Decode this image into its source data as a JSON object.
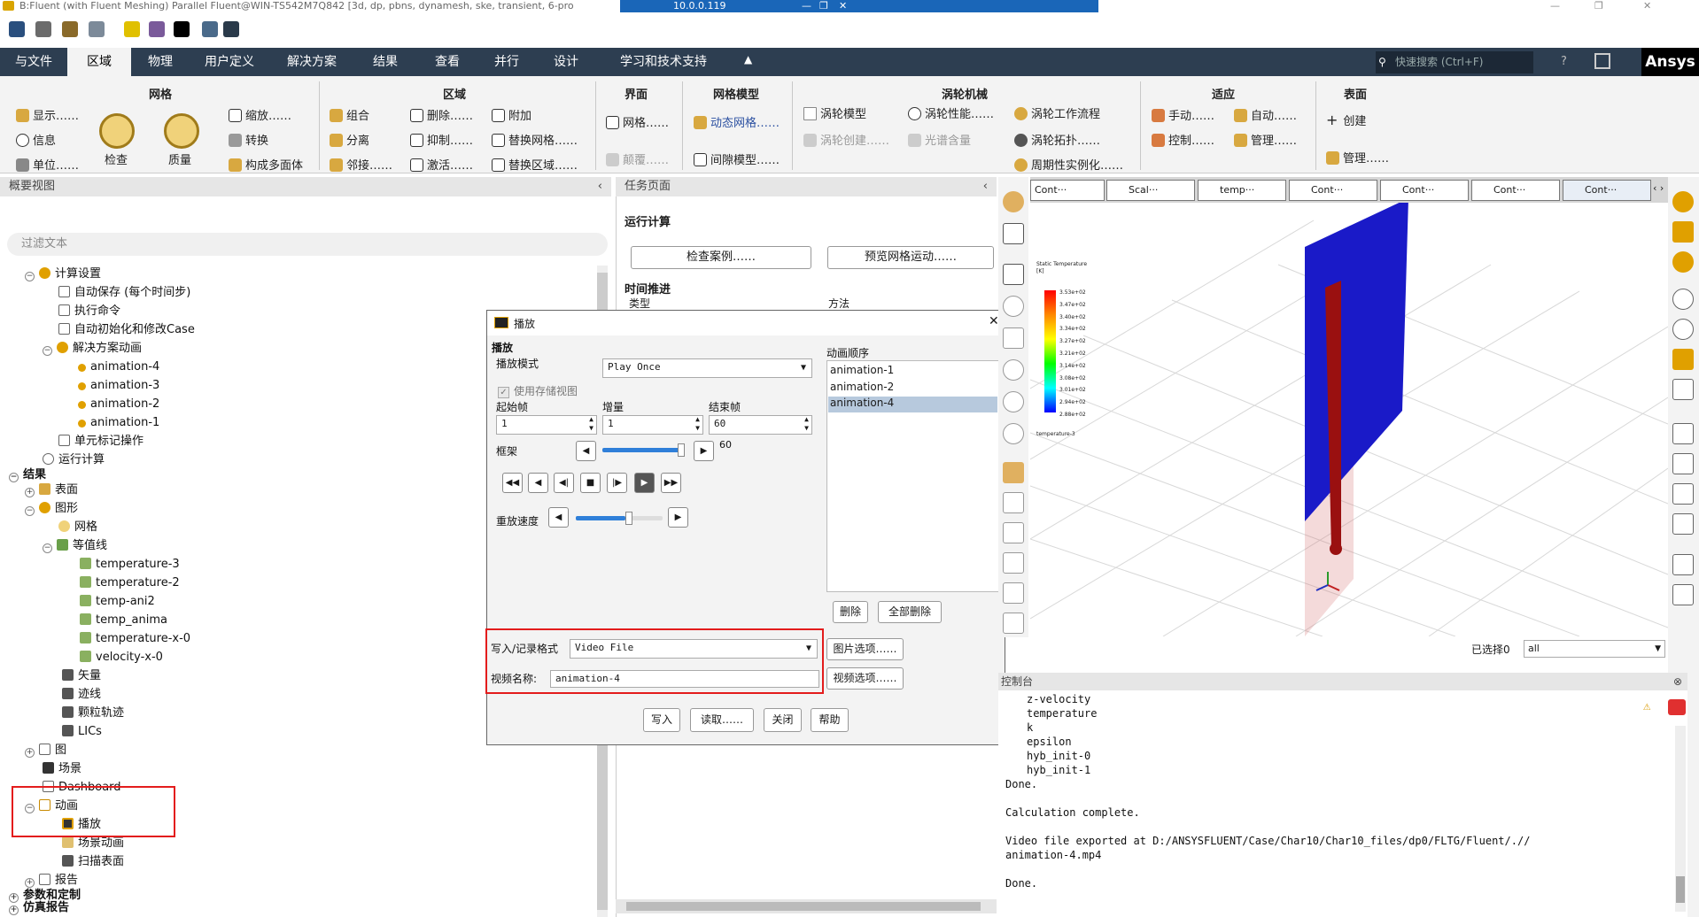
{
  "titlebar": {
    "title": "B:Fluent (with Fluent Meshing) Parallel Fluent@WIN-TS542M7Q842  [3d, dp, pbns, dynamesh, ske, transient, 6-pro",
    "remote": "10.0.0.119"
  },
  "menubar": {
    "items": [
      "与文件",
      "区域",
      "物理",
      "用户定义",
      "解决方案",
      "结果",
      "查看",
      "并行",
      "设计",
      "学习和技术支持"
    ],
    "active": "区域",
    "search_placeholder": "快速搜索  (Ctrl+F)",
    "brand": "Ansys"
  },
  "ribbon": {
    "sections": [
      "网格",
      "区域",
      "界面",
      "网格模型",
      "涡轮机械",
      "适应",
      "表面"
    ],
    "mesh": [
      "显示……",
      "信息",
      "单位……",
      "检查",
      "质量",
      "缩放……",
      "转换",
      "构成多面体"
    ],
    "zones": [
      "组合",
      "分离",
      "邻接……",
      "删除……",
      "抑制……",
      "激活……",
      "附加",
      "替换网格……",
      "替换区域……"
    ],
    "interface": [
      "网格……",
      "颠覆……"
    ],
    "meshmodel": [
      "动态网格……",
      "间隙模型……"
    ],
    "turbo": [
      "涡轮模型",
      "涡轮创建……",
      "涡轮性能……",
      "光谱含量",
      "涡轮工作流程",
      "涡轮拓扑……",
      "周期性实例化……"
    ],
    "adapt": [
      "手动……",
      "控制……",
      "自动……",
      "管理……"
    ],
    "surface": [
      "创建",
      "管理……"
    ]
  },
  "outline": {
    "header": "概要视图",
    "filter_placeholder": "过滤文本",
    "items": [
      "计算设置",
      "自动保存 (每个时间步)",
      "执行命令",
      "自动初始化和修改Case",
      "解决方案动画",
      "animation-4",
      "animation-3",
      "animation-2",
      "animation-1",
      "单元标记操作",
      "运行计算",
      "结果",
      "表面",
      "图形",
      "网格",
      "等值线",
      "temperature-3",
      "temperature-2",
      "temp-ani2",
      "temp_anima",
      "temperature-x-0",
      "velocity-x-0",
      "矢量",
      "迹线",
      "颗粒轨迹",
      "LICs",
      "图",
      "场景",
      "Dashboard",
      "动画",
      "播放",
      "场景动画",
      "扫描表面",
      "报告",
      "参数和定制",
      "仿真报告"
    ]
  },
  "task": {
    "header": "任务页面",
    "title": "运行计算",
    "btn_check": "检查案例……",
    "btn_preview": "预览网格运动……",
    "time_adv": "时间推进",
    "type": "类型",
    "method": "方法"
  },
  "dialog": {
    "title": "播放",
    "group": "播放",
    "play_mode_label": "播放模式",
    "play_mode": "Play Once",
    "use_stored": "使用存储视图",
    "start_label": "起始帧",
    "start": "1",
    "inc_label": "增量",
    "inc": "1",
    "end_label": "结束帧",
    "end": "60",
    "frame_label": "框架",
    "frame_value": "60",
    "speed_label": "重放速度",
    "seq_label": "动画顺序",
    "seq": [
      "animation-1",
      "animation-2",
      "animation-4"
    ],
    "selected_seq": "animation-4",
    "delete": "删除",
    "delete_all": "全部删除",
    "write_fmt_label": "写入/记录格式",
    "write_fmt": "Video File",
    "video_name_label": "视频名称:",
    "video_name": "animation-4",
    "pic_opt": "图片选项……",
    "video_opt": "视频选项……",
    "btn_write": "写入",
    "btn_read": "读取……",
    "btn_close": "关闭",
    "btn_help": "帮助"
  },
  "graphics": {
    "tabs": [
      "Cont···",
      "Scal···",
      "temp···",
      "Cont···",
      "Cont···",
      "Cont···",
      "Cont···"
    ],
    "active_tab": 6,
    "legend_title": "Static Temperature\n[K]",
    "legend_values": [
      "3.53e+02",
      "3.47e+02",
      "3.40e+02",
      "3.34e+02",
      "3.27e+02",
      "3.21e+02",
      "3.14e+02",
      "3.08e+02",
      "3.01e+02",
      "2.94e+02",
      "2.88e+02"
    ],
    "legend_caption": "temperature-3",
    "selected_label": "已选择0",
    "selected_value": "all"
  },
  "console": {
    "header": "控制台",
    "lines": [
      "z-velocity",
      "temperature",
      "k",
      "epsilon",
      "hyb_init-0",
      "hyb_init-1",
      "Done.",
      "",
      "Calculation complete.",
      "",
      "Video file exported at D:/ANSYSFLUENT/Case/Char10/Char10_files/dp0/FLTG/Fluent/.//",
      "animation-4.mp4",
      "",
      "Done."
    ]
  }
}
